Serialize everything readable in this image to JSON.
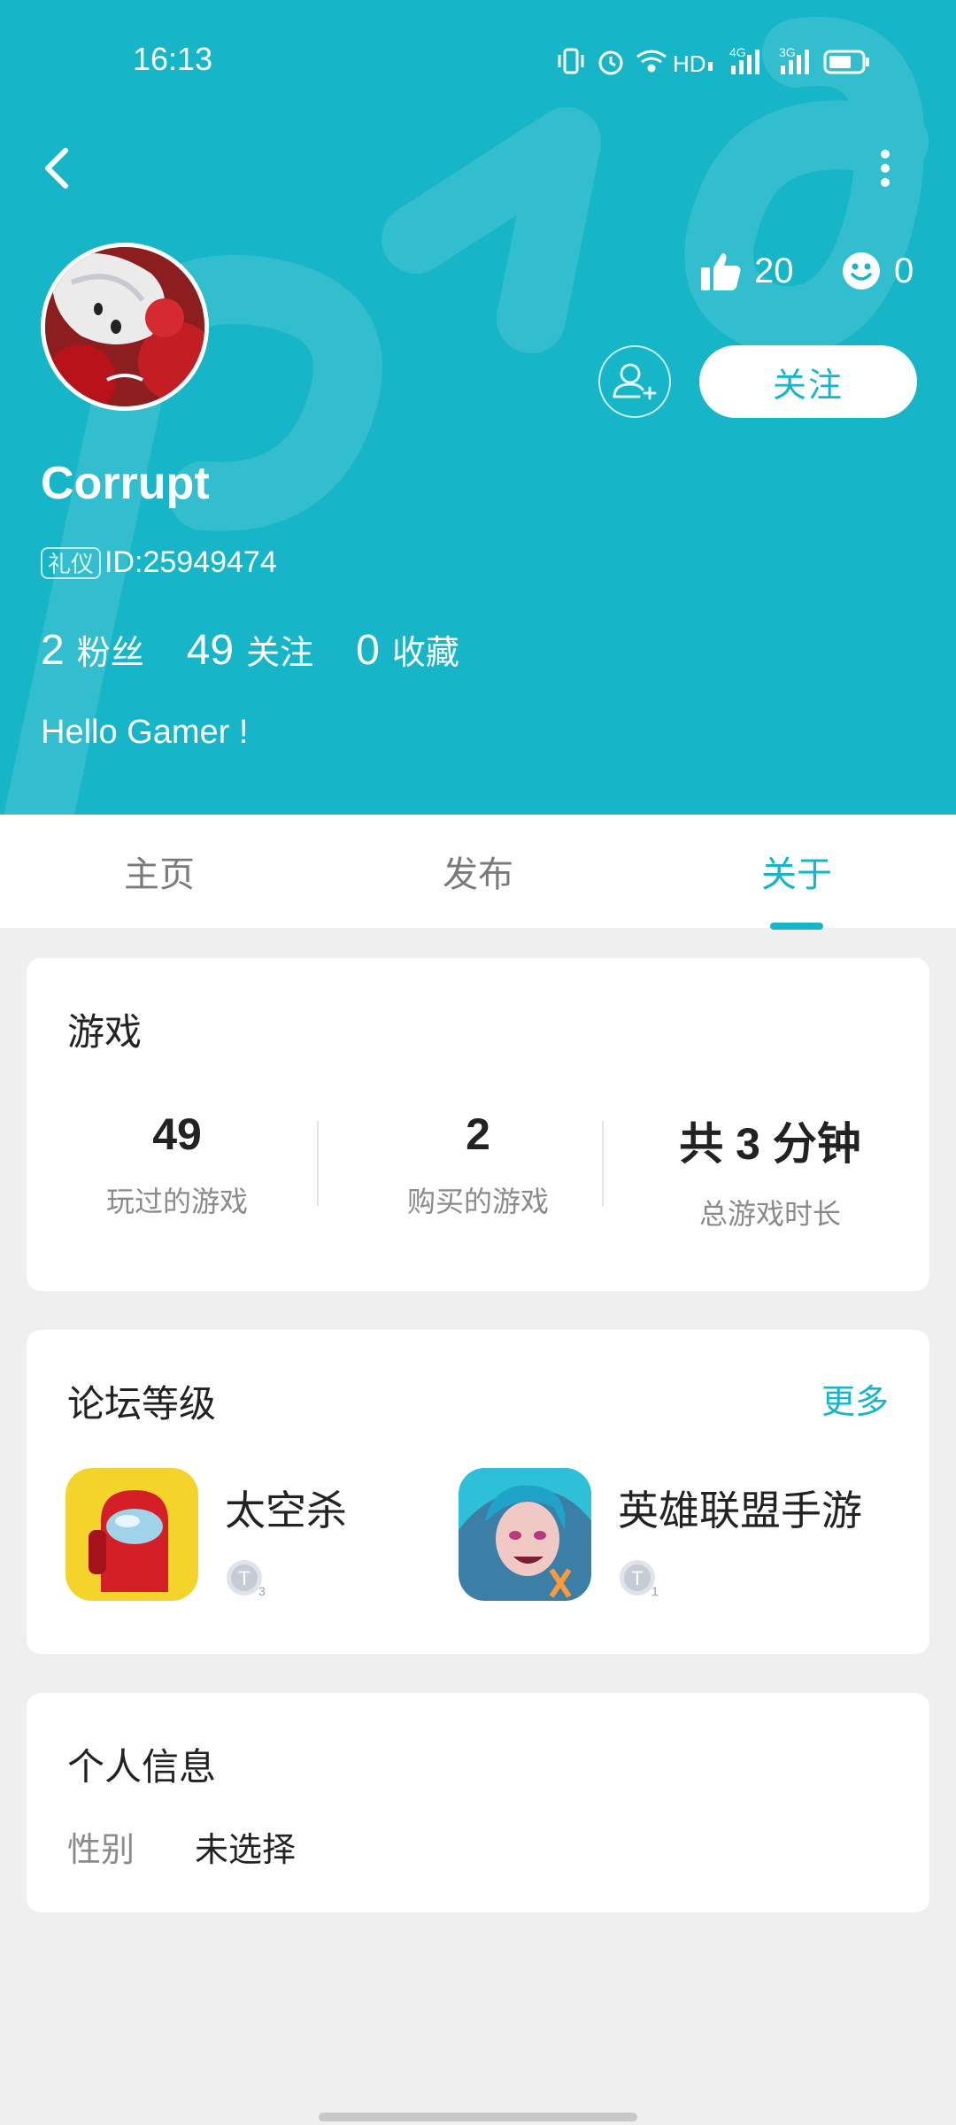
{
  "status_bar": {
    "time": "16:13",
    "network_label": "HD",
    "net_4g": "4G",
    "net_3g": "3G"
  },
  "header": {
    "likes_count": "20",
    "smiles_count": "0",
    "follow_label": "关注",
    "username": "Corrupt",
    "badge": "礼仪",
    "user_id": "ID:25949474",
    "counts": [
      {
        "value": "2",
        "label": "粉丝"
      },
      {
        "value": "49",
        "label": "关注"
      },
      {
        "value": "0",
        "label": "收藏"
      }
    ],
    "bio": "Hello Gamer !"
  },
  "tabs": [
    {
      "label": "主页",
      "active": false
    },
    {
      "label": "发布",
      "active": false
    },
    {
      "label": "关于",
      "active": true
    }
  ],
  "games_card": {
    "title": "游戏",
    "stats": [
      {
        "value": "49",
        "label": "玩过的游戏"
      },
      {
        "value": "2",
        "label": "购买的游戏"
      },
      {
        "value": "共 3 分钟",
        "label": "总游戏时长"
      }
    ]
  },
  "forum_card": {
    "title": "论坛等级",
    "more_label": "更多",
    "games": [
      {
        "name": "太空杀",
        "level": "3"
      },
      {
        "name": "英雄联盟手游",
        "level": "1"
      }
    ]
  },
  "info_card": {
    "title": "个人信息",
    "gender_label": "性别",
    "gender_value": "未选择"
  },
  "colors": {
    "accent": "#16b6c8",
    "background": "#efefef"
  }
}
